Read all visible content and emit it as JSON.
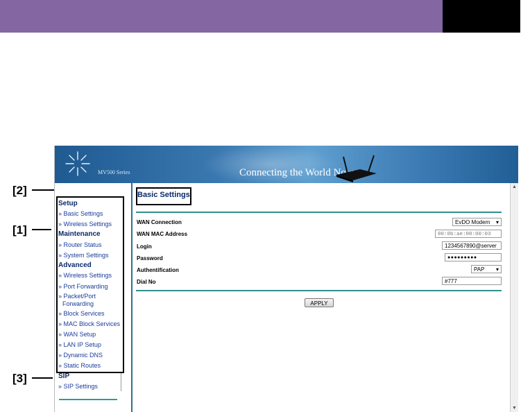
{
  "banner": {
    "series": "MV500 Series",
    "tagline": "Connecting the World Now"
  },
  "callouts": {
    "c1": "[1]",
    "c2": "[2]",
    "c3": "[3]"
  },
  "sidebar": {
    "setup_heading": "Setup",
    "setup_items": [
      "» Basic Settings",
      "» Wireless Settings"
    ],
    "maintenance_heading": "Maintenance",
    "maintenance_items": [
      "» Router Status",
      "» System Settings"
    ],
    "advanced_heading": "Advanced",
    "advanced_items": [
      "» Wireless Settings",
      "» Port Forwarding",
      "» Packet/Port",
      "Forwarding",
      "» Block Services",
      "» MAC Block Services",
      "» WAN Setup",
      "» LAN IP Setup",
      "» Dynamic DNS",
      "» Static Routes"
    ],
    "sip_heading": "SIP",
    "sip_items": [
      "» SIP Settings"
    ]
  },
  "main": {
    "title": "Basic Settings",
    "rows": [
      {
        "label": "WAN Connection",
        "value": "EvDO Modem"
      },
      {
        "label": "WAN MAC Address",
        "value": "00:0b:ae:00:00:03"
      },
      {
        "label": "Login",
        "value": "1234567890@server"
      },
      {
        "label": "Password",
        "value": "●●●●●●●●●"
      },
      {
        "label": "Authentification",
        "value": "PAP"
      },
      {
        "label": "Dial No",
        "value": "#777"
      }
    ],
    "apply_label": "APPLY"
  },
  "colors": {
    "header_bar": "#8466a3",
    "accent_rule": "#2f8f8f",
    "nav_link": "#1a3c9a"
  }
}
